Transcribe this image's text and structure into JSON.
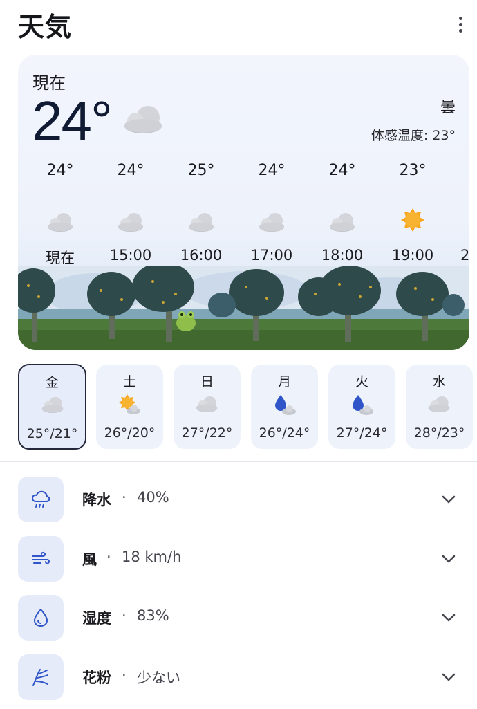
{
  "app": {
    "title": "天気"
  },
  "current": {
    "label": "現在",
    "temperature": "24°",
    "condition": "曇",
    "feels_like": "体感温度: 23°",
    "icon": "cloud-icon"
  },
  "hourly": [
    {
      "temp": "24°",
      "time": "現在",
      "icon": "cloud-icon"
    },
    {
      "temp": "24°",
      "time": "15:00",
      "icon": "cloud-icon"
    },
    {
      "temp": "25°",
      "time": "16:00",
      "icon": "cloud-icon"
    },
    {
      "temp": "24°",
      "time": "17:00",
      "icon": "cloud-icon"
    },
    {
      "temp": "24°",
      "time": "18:00",
      "icon": "cloud-icon"
    },
    {
      "temp": "23°",
      "time": "19:00",
      "icon": "sun-icon"
    }
  ],
  "hourly_clipped": "2",
  "daily": [
    {
      "day": "金",
      "range": "25°/21°",
      "icon": "cloud-icon",
      "selected": true
    },
    {
      "day": "土",
      "range": "26°/20°",
      "icon": "sun-cloud-icon",
      "selected": false
    },
    {
      "day": "日",
      "range": "27°/22°",
      "icon": "cloud-icon",
      "selected": false
    },
    {
      "day": "月",
      "range": "26°/24°",
      "icon": "rain-cloud-icon",
      "selected": false
    },
    {
      "day": "火",
      "range": "27°/24°",
      "icon": "rain-cloud-icon",
      "selected": false
    },
    {
      "day": "水",
      "range": "28°/23°",
      "icon": "cloud-icon",
      "selected": false
    }
  ],
  "details": [
    {
      "label": "降水",
      "separator": "·",
      "value": "40%",
      "icon": "rain-icon"
    },
    {
      "label": "風",
      "separator": "·",
      "value": "18 km/h",
      "icon": "wind-icon"
    },
    {
      "label": "湿度",
      "separator": "·",
      "value": "83%",
      "icon": "droplet-icon"
    },
    {
      "label": "花粉",
      "separator": "·",
      "value": "少ない",
      "icon": "pollen-icon"
    }
  ],
  "colors": {
    "accent": "#2f55c8",
    "card_bg": "#eef2fb",
    "icon_tile": "#e6ebfa",
    "sun": "#f5a623",
    "cloud": "#c9ccd2"
  }
}
